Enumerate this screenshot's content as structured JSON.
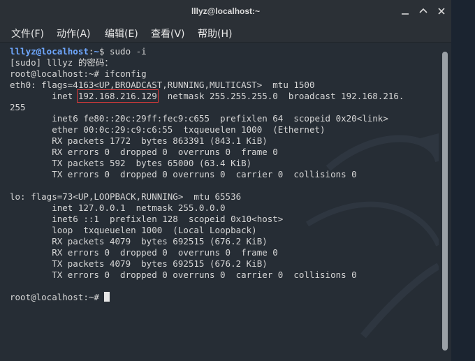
{
  "window": {
    "title": "lllyz@localhost:~"
  },
  "menu": [
    "文件(F)",
    "动作(A)",
    "编辑(E)",
    "查看(V)",
    "帮助(H)"
  ],
  "terminal": {
    "l1_user": "lllyz@localhost",
    "l1_sep": ":",
    "l1_path": "~",
    "l1_cmd": "$ sudo -i",
    "l2": "[sudo] lllyz 的密码：",
    "l3": "root@localhost:~# ifconfig",
    "l4": "eth0: flags=4163<UP,BROADCAST,RUNNING,MULTICAST>  mtu 1500",
    "l5_pre": "        inet ",
    "l5_ip": "192.168.216.129",
    "l5_post": "  netmask 255.255.255.0  broadcast 192.168.216.",
    "l6": "255",
    "l7": "        inet6 fe80::20c:29ff:fec9:c655  prefixlen 64  scopeid 0x20<link>",
    "l8": "        ether 00:0c:29:c9:c6:55  txqueuelen 1000  (Ethernet)",
    "l9": "        RX packets 1772  bytes 863391 (843.1 KiB)",
    "l10": "        RX errors 0  dropped 0  overruns 0  frame 0",
    "l11": "        TX packets 592  bytes 65000 (63.4 KiB)",
    "l12": "        TX errors 0  dropped 0 overruns 0  carrier 0  collisions 0",
    "l13": "",
    "l14": "lo: flags=73<UP,LOOPBACK,RUNNING>  mtu 65536",
    "l15": "        inet 127.0.0.1  netmask 255.0.0.0",
    "l16": "        inet6 ::1  prefixlen 128  scopeid 0x10<host>",
    "l17": "        loop  txqueuelen 1000  (Local Loopback)",
    "l18": "        RX packets 4079  bytes 692515 (676.2 KiB)",
    "l19": "        RX errors 0  dropped 0  overruns 0  frame 0",
    "l20": "        TX packets 4079  bytes 692515 (676.2 KiB)",
    "l21": "        TX errors 0  dropped 0 overruns 0  carrier 0  collisions 0",
    "l22": "",
    "l23": "root@localhost:~# "
  },
  "colors": {
    "prompt": "#6fa8ff",
    "highlight_box": "#e03a3a",
    "terminal_bg": "#262d35"
  },
  "icons": [
    "minimize-icon",
    "maximize-icon",
    "close-icon"
  ]
}
